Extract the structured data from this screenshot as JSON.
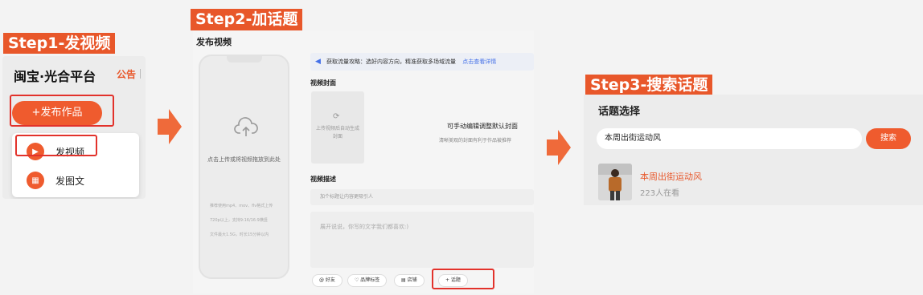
{
  "steps": [
    {
      "label": "Step1-发视频"
    },
    {
      "label": "Step2-加话题"
    },
    {
      "label": "Step3-搜索话题"
    }
  ],
  "panel1": {
    "logo": "闽宝·光合平台",
    "notice": "公告",
    "publish_button": "+发布作品",
    "menu": [
      {
        "label": "发视频",
        "icon": "video-icon"
      },
      {
        "label": "发图文",
        "icon": "image-text-icon"
      }
    ]
  },
  "panel2": {
    "title": "发布视频",
    "upload_hint": "点击上传或将视频拖放到此处",
    "requirements": [
      "推荐使用mp4、mov、flv格式上传",
      "720p以上，支持9:16/16:9横竖",
      "文件最大1.5G，时长15分钟以内"
    ],
    "tip": "获取流量攻略：选好内容方向，精准获取多场域流量",
    "tip_link": "点击查看详情",
    "cover_label": "视频封面",
    "cover_generating": "上传视频后自动生成封面",
    "cover_main": "可手动编辑调整默认封面",
    "cover_sub": "清晰美观的封面有利于作品被推荐",
    "desc_label": "视频描述",
    "title_placeholder": "加个标题让内容更吸引人",
    "desc_placeholder": "展开说说，你写的文字我们都喜欢:)",
    "tags": [
      "@ 好友",
      "品牌标签",
      "店铺",
      "+ 话题"
    ]
  },
  "panel3": {
    "title": "话题选择",
    "search_value": "本周出街运动风",
    "search_button": "搜索",
    "topic": "本周出街运动风",
    "viewers": "223人在看"
  },
  "colors": {
    "accent": "#ef5b2e",
    "highlight_border": "#e2322b",
    "link": "#4470e8"
  }
}
